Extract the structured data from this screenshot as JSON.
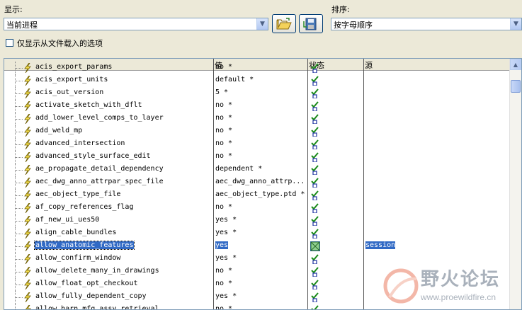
{
  "display": {
    "label": "显示:",
    "selected": "当前进程"
  },
  "sort": {
    "label": "排序:",
    "selected": "按字母顺序"
  },
  "checkbox": {
    "label": "仅显示从文件载入的选项",
    "checked": false
  },
  "columns": {
    "name": "",
    "value": "值",
    "status": "状态",
    "source": "源"
  },
  "rows": [
    {
      "name": "acis_export_params",
      "value": "no *",
      "source": ""
    },
    {
      "name": "acis_export_units",
      "value": "default *",
      "source": ""
    },
    {
      "name": "acis_out_version",
      "value": "5 *",
      "source": ""
    },
    {
      "name": "activate_sketch_with_dflt",
      "value": "no *",
      "source": ""
    },
    {
      "name": "add_lower_level_comps_to_layer",
      "value": "no *",
      "source": ""
    },
    {
      "name": "add_weld_mp",
      "value": "no *",
      "source": ""
    },
    {
      "name": "advanced_intersection",
      "value": "no *",
      "source": ""
    },
    {
      "name": "advanced_style_surface_edit",
      "value": "no *",
      "source": ""
    },
    {
      "name": "ae_propagate_detail_dependency",
      "value": "dependent *",
      "source": ""
    },
    {
      "name": "aec_dwg_anno_attrpar_spec_file",
      "value": "aec_dwg_anno_attrp...",
      "source": ""
    },
    {
      "name": "aec_object_type_file",
      "value": "aec_object_type.ptd *",
      "source": ""
    },
    {
      "name": "af_copy_references_flag",
      "value": "no *",
      "source": ""
    },
    {
      "name": "af_new_ui_ues50",
      "value": "yes *",
      "source": ""
    },
    {
      "name": "align_cable_bundles",
      "value": "yes *",
      "source": ""
    },
    {
      "name": "allow_anatomic_features",
      "value": "yes",
      "source": "session",
      "selected": true
    },
    {
      "name": "allow_confirm_window",
      "value": "yes *",
      "source": ""
    },
    {
      "name": "allow_delete_many_in_drawings",
      "value": "no *",
      "source": ""
    },
    {
      "name": "allow_float_opt_checkout",
      "value": "no *",
      "source": ""
    },
    {
      "name": "allow_fully_dependent_copy",
      "value": "yes *",
      "source": ""
    },
    {
      "name": "allow_harn_mfg_assy_retrieval",
      "value": "no *",
      "source": ""
    }
  ],
  "watermark": {
    "title": "野火论坛",
    "url": "www.proewildfire.cn"
  }
}
